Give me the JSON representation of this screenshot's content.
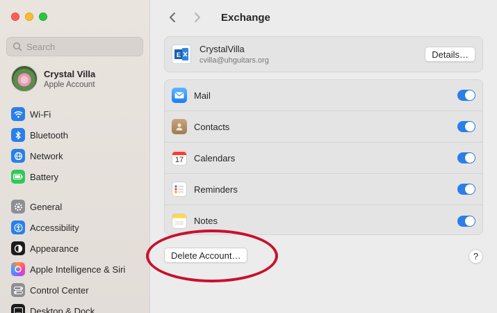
{
  "window": {
    "traffic_lights": {
      "close": "#ff5f57",
      "minimize": "#febc2e",
      "maximize": "#28c840"
    }
  },
  "sidebar": {
    "search_placeholder": "Search",
    "account": {
      "name": "Crystal Villa",
      "subtitle": "Apple Account"
    },
    "groups": [
      [
        {
          "label": "Wi-Fi",
          "icon": "wifi-icon"
        },
        {
          "label": "Bluetooth",
          "icon": "bluetooth-icon"
        },
        {
          "label": "Network",
          "icon": "network-icon"
        },
        {
          "label": "Battery",
          "icon": "battery-icon"
        }
      ],
      [
        {
          "label": "General",
          "icon": "gear-icon"
        },
        {
          "label": "Accessibility",
          "icon": "accessibility-icon"
        },
        {
          "label": "Appearance",
          "icon": "appearance-icon"
        },
        {
          "label": "Apple Intelligence & Siri",
          "icon": "siri-icon"
        },
        {
          "label": "Control Center",
          "icon": "control-center-icon"
        },
        {
          "label": "Desktop & Dock",
          "icon": "dock-icon"
        }
      ]
    ]
  },
  "toolbar": {
    "title": "Exchange"
  },
  "account_card": {
    "name": "CrystalVilla",
    "email": "cvilla@uhguitars.org",
    "details_label": "Details…"
  },
  "services": [
    {
      "label": "Mail",
      "icon": "mail-icon",
      "enabled": true
    },
    {
      "label": "Contacts",
      "icon": "contacts-icon",
      "enabled": true
    },
    {
      "label": "Calendars",
      "icon": "calendar-icon",
      "enabled": true,
      "calendar_day": "17"
    },
    {
      "label": "Reminders",
      "icon": "reminders-icon",
      "enabled": true
    },
    {
      "label": "Notes",
      "icon": "notes-icon",
      "enabled": true
    }
  ],
  "footer": {
    "delete_label": "Delete Account…",
    "help_label": "?"
  },
  "colors": {
    "accent": "#2a7fe8",
    "annotation": "#c8102e"
  }
}
